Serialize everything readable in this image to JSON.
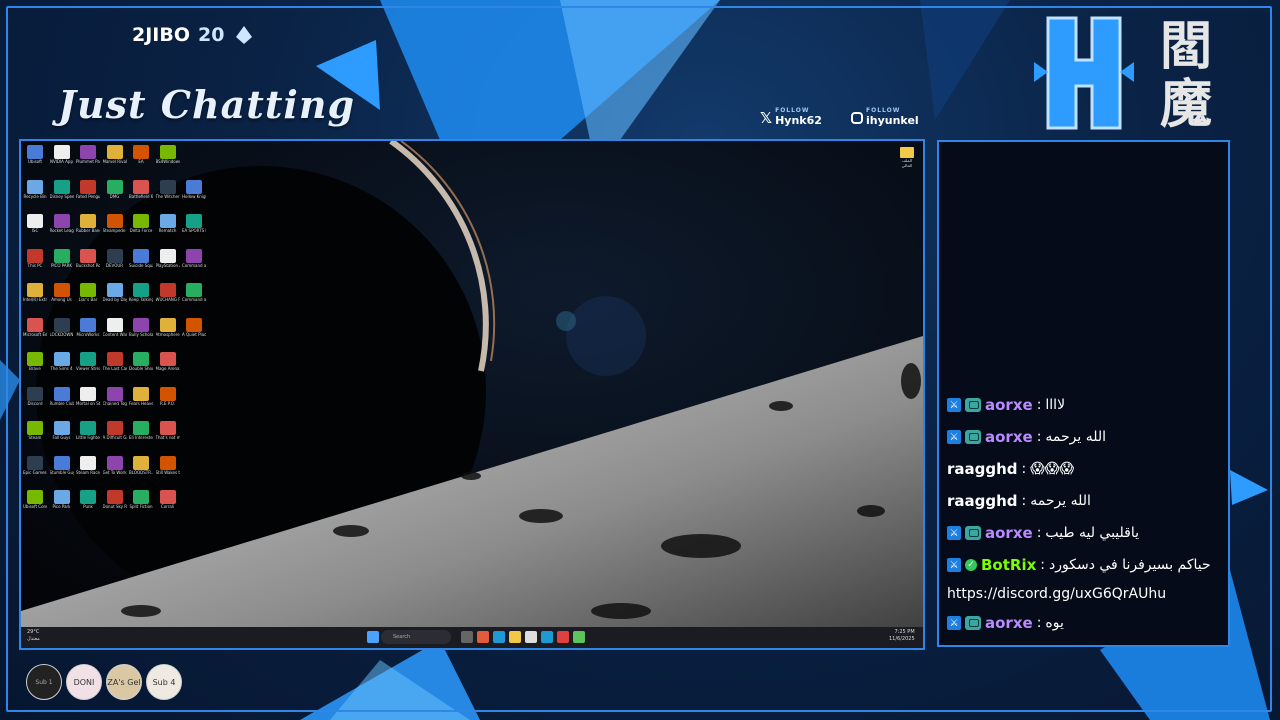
{
  "header": {
    "username": "2JIBO",
    "count": "20",
    "category": "Just Chatting"
  },
  "socials": [
    {
      "platform": "X",
      "follow_label": "FOLLOW",
      "handle": "Hynk62"
    },
    {
      "platform": "Instagram",
      "follow_label": "FOLLOW",
      "handle": "ihyunkel"
    }
  ],
  "logo": {
    "letter": "H",
    "kanji_top": "閻",
    "kanji_bottom": "魔"
  },
  "desktop": {
    "folder_label": "الملف الحالي",
    "taskbar": {
      "weather": "29°C",
      "weather_sub": "معتدل",
      "search_placeholder": "Search",
      "time": "7:25 PM",
      "date": "11/6/2025"
    },
    "icons": [
      "Ubisoft",
      "NVIDIA App",
      "Plummet Party",
      "Marvel Rivals",
      "EA",
      "BS4Windows",
      "Recycle Bin",
      "Disney Speedstorm",
      "Fated Penguin",
      "DMG",
      "Battlefield 6",
      "The Witcher 3 Wild Hunt",
      "Hollow Knight",
      "ISC",
      "Rocket League",
      "Rubber Bandits",
      "Steampede Racing",
      "Delta Force",
      "Rematch",
      "EA SPORTS FC 25",
      "This PC",
      "PICO PARK",
      "Buckshot Roulette",
      "DEVOUR",
      "Suicide Squad Ki...",
      "PlayStation Accessories",
      "Command and Conquer",
      "Intel(R) Extre...",
      "Among Us",
      "Liar's Bar",
      "Dead by Daylight",
      "Keep Talking and Nobo...",
      "WUCHANG Fallen Fea...",
      "Command and Conqu...",
      "Microsoft Edge",
      "LOCKDOWN Protocol",
      "MicroWorks",
      "Content Warning",
      "Bully Scholarsh...",
      "Atmosphere 3",
      "A Quiet Place The Road A...",
      "Brave",
      "The Sims 4",
      "Viewer Stream ch...",
      "The Last Campfire",
      "Double Shoulders",
      "Mage Arena",
      "Discord",
      "Rumble Club",
      "Mortal on Stream",
      "Chained Together",
      "Fears Heaven 1",
      "R.E.P.O.",
      "Steam",
      "Fall Guys",
      "Little Fighters on Stream",
      "A Difficult Game Abo...",
      "Eli Interested",
      "That's not my Neighbor",
      "Epic Games Launcher",
      "Stumble Guys",
      "Steam Racer",
      "Get To Work",
      "BLOODSTR...",
      "Still Wakes the Deep",
      "Ubisoft Connect",
      "Pico Park",
      "Punk",
      "Donut Sky Riders",
      "Split Fiction",
      "Corrali"
    ]
  },
  "chat": {
    "messages": [
      {
        "user": "aorxe",
        "text": "لاااا",
        "user_color": "#b98bff",
        "badges": [
          "mod",
          "ai"
        ]
      },
      {
        "user": "aorxe",
        "text": "الله يرحمه",
        "user_color": "#b98bff",
        "badges": [
          "mod",
          "ai"
        ]
      },
      {
        "user": "raagghd",
        "text": "😱😱😱",
        "user_color": "#ffffff",
        "badges": []
      },
      {
        "user": "raagghd",
        "text": "الله يرحمه",
        "user_color": "#ffffff",
        "badges": []
      },
      {
        "user": "aorxe",
        "text": "ياقليبي ليه طيب",
        "user_color": "#b98bff",
        "badges": [
          "mod",
          "ai"
        ]
      },
      {
        "user": "BotRix",
        "text": "حياكم بسيرفرنا في دسكورد",
        "user_color": "#7CFC00",
        "badges": [
          "mod",
          "ok"
        ]
      },
      {
        "user": "aorxe",
        "text": "يوه",
        "user_color": "#b98bff",
        "badges": [
          "mod",
          "ai"
        ]
      }
    ],
    "link": "https://discord.gg/uxG6QrAUhu",
    "separator": " : "
  },
  "subs": [
    {
      "label": "Sub 1"
    },
    {
      "label": "DONI"
    },
    {
      "label": "ZA's Gel"
    },
    {
      "label": "Sub 4"
    }
  ],
  "colors": {
    "accent": "#2f86e6",
    "chat_bg": "#050b18",
    "frame_bg": "#0a2245"
  }
}
